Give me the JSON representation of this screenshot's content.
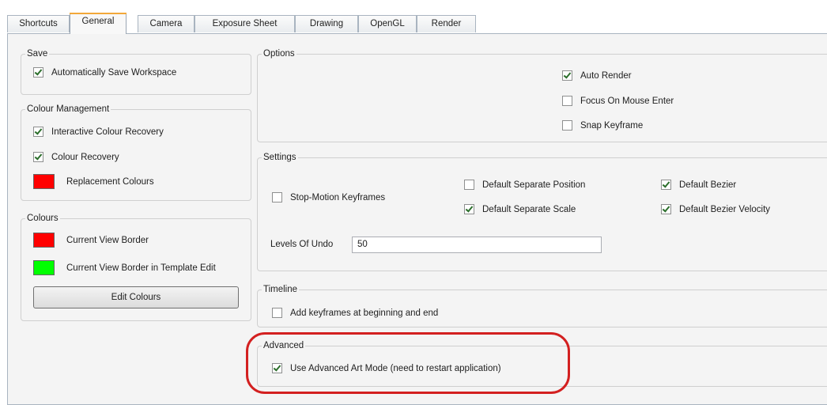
{
  "tabs": [
    "Shortcuts",
    "General",
    "Camera",
    "Exposure Sheet",
    "Drawing",
    "OpenGL",
    "Render"
  ],
  "active_tab": "General",
  "save": {
    "title": "Save",
    "auto_save": {
      "label": "Automatically Save Workspace",
      "checked": true
    }
  },
  "colour_management": {
    "title": "Colour Management",
    "interactive_recovery": {
      "label": "Interactive Colour Recovery",
      "checked": true
    },
    "colour_recovery": {
      "label": "Colour Recovery",
      "checked": true
    },
    "replacement": {
      "label": "Replacement Colours",
      "color": "#ff0000"
    }
  },
  "colours": {
    "title": "Colours",
    "view_border": {
      "label": "Current View Border",
      "color": "#ff0000"
    },
    "template_border": {
      "label": "Current View Border in Template Edit",
      "color": "#00ff00"
    },
    "edit_button": "Edit Colours"
  },
  "options": {
    "title": "Options",
    "auto_render": {
      "label": "Auto Render",
      "checked": true
    },
    "focus_mouse": {
      "label": "Focus On Mouse Enter",
      "checked": false
    },
    "snap_keyframe": {
      "label": "Snap Keyframe",
      "checked": false
    }
  },
  "settings": {
    "title": "Settings",
    "stop_motion": {
      "label": "Stop-Motion Keyframes",
      "checked": false
    },
    "sep_position": {
      "label": "Default Separate Position",
      "checked": false
    },
    "sep_scale": {
      "label": "Default Separate Scale",
      "checked": true
    },
    "bezier": {
      "label": "Default Bezier",
      "checked": true
    },
    "bezier_velocity": {
      "label": "Default Bezier Velocity",
      "checked": true
    },
    "levels_undo_label": "Levels Of Undo",
    "levels_undo_value": "50"
  },
  "timeline": {
    "title": "Timeline",
    "add_keyframes": {
      "label": "Add keyframes at beginning and end",
      "checked": false
    }
  },
  "advanced": {
    "title": "Advanced",
    "art_mode": {
      "label": "Use Advanced Art Mode (need to restart application)",
      "checked": true
    }
  },
  "highlight_color": "#d32020"
}
